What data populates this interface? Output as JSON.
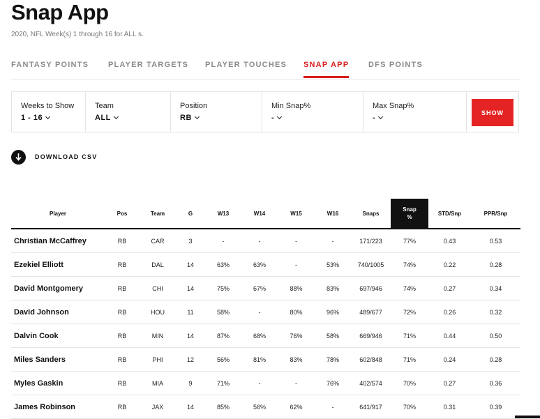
{
  "page": {
    "title": "Snap App",
    "subtitle": "2020, NFL Week(s) 1 through 16 for ALL s."
  },
  "tabs": [
    {
      "label": "FANTASY POINTS",
      "active": false
    },
    {
      "label": "PLAYER TARGETS",
      "active": false
    },
    {
      "label": "PLAYER TOUCHES",
      "active": false
    },
    {
      "label": "SNAP APP",
      "active": true
    },
    {
      "label": "DFS POINTS",
      "active": false
    }
  ],
  "filters": {
    "weeks": {
      "label": "Weeks to Show",
      "value": "1 - 16"
    },
    "team": {
      "label": "Team",
      "value": "ALL"
    },
    "position": {
      "label": "Position",
      "value": "RB"
    },
    "min_snap": {
      "label": "Min Snap%",
      "value": "-"
    },
    "max_snap": {
      "label": "Max Snap%",
      "value": "-"
    },
    "show_label": "SHOW"
  },
  "download_label": "DOWNLOAD CSV",
  "colors": {
    "accent": "#e42424",
    "active_tab": "#d81e1e",
    "header_active": "#111111"
  },
  "table": {
    "headers": [
      "Player",
      "Pos",
      "Team",
      "G",
      "W13",
      "W14",
      "W15",
      "W16",
      "Snaps",
      "Snap %",
      "STD/Snp",
      "PPR/Snp"
    ],
    "rows": [
      [
        "Christian McCaffrey",
        "RB",
        "CAR",
        "3",
        "-",
        "-",
        "-",
        "-",
        "171/223",
        "77%",
        "0.43",
        "0.53"
      ],
      [
        "Ezekiel Elliott",
        "RB",
        "DAL",
        "14",
        "63%",
        "63%",
        "-",
        "53%",
        "740/1005",
        "74%",
        "0.22",
        "0.28"
      ],
      [
        "David Montgomery",
        "RB",
        "CHI",
        "14",
        "75%",
        "67%",
        "88%",
        "83%",
        "697/946",
        "74%",
        "0.27",
        "0.34"
      ],
      [
        "David Johnson",
        "RB",
        "HOU",
        "11",
        "58%",
        "-",
        "80%",
        "96%",
        "489/677",
        "72%",
        "0.26",
        "0.32"
      ],
      [
        "Dalvin Cook",
        "RB",
        "MIN",
        "14",
        "87%",
        "68%",
        "76%",
        "58%",
        "669/946",
        "71%",
        "0.44",
        "0.50"
      ],
      [
        "Miles Sanders",
        "RB",
        "PHI",
        "12",
        "56%",
        "81%",
        "83%",
        "78%",
        "602/848",
        "71%",
        "0.24",
        "0.28"
      ],
      [
        "Myles Gaskin",
        "RB",
        "MIA",
        "9",
        "71%",
        "-",
        "-",
        "76%",
        "402/574",
        "70%",
        "0.27",
        "0.36"
      ],
      [
        "James Robinson",
        "RB",
        "JAX",
        "14",
        "85%",
        "56%",
        "62%",
        "-",
        "641/917",
        "70%",
        "0.31",
        "0.39"
      ]
    ]
  }
}
